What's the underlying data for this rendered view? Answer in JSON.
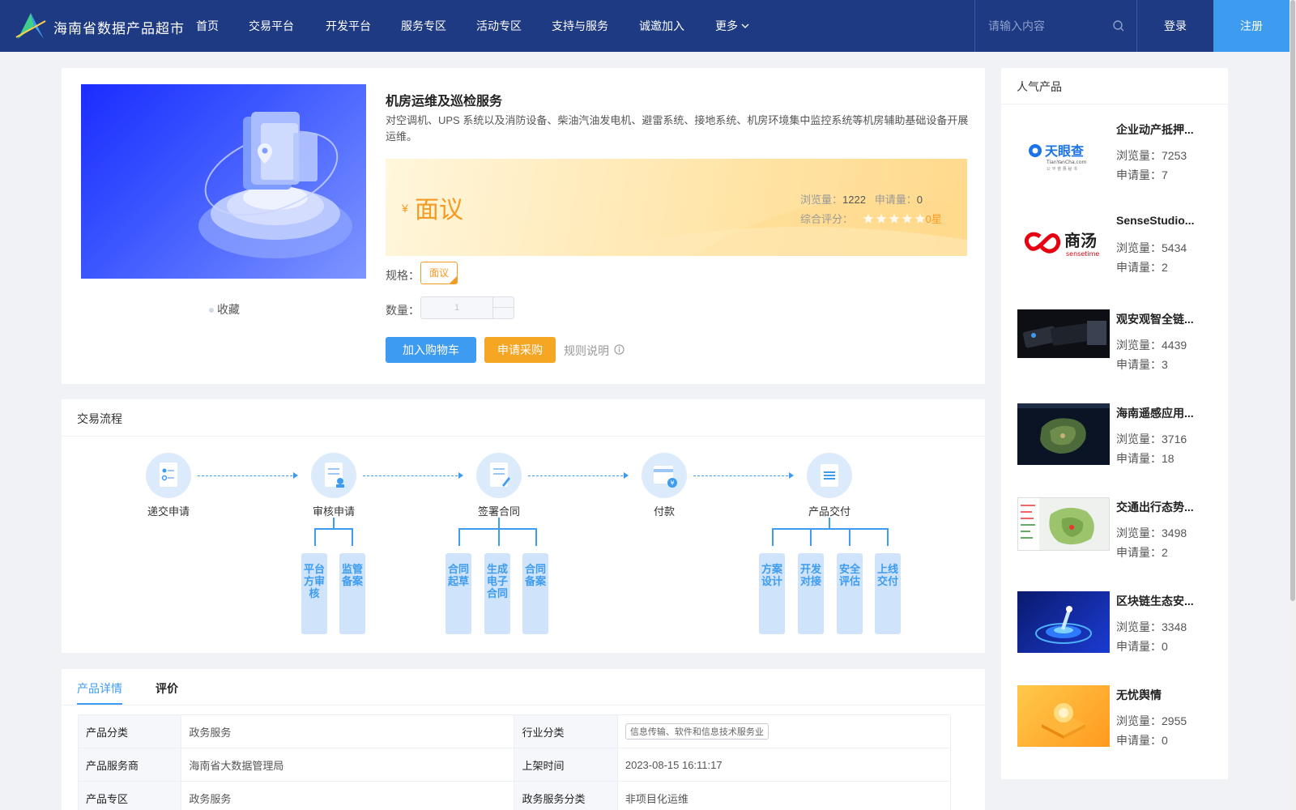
{
  "header": {
    "brand": "海南省数据产品超市",
    "nav": [
      "首页",
      "交易平台",
      "开发平台",
      "服务专区",
      "活动专区",
      "支持与服务",
      "诚邀加入",
      "更多"
    ],
    "search_placeholder": "请输入内容",
    "login": "登录",
    "register": "注册",
    "colors": {
      "bar": "#1d3a82",
      "accent": "#3e9cf0"
    }
  },
  "product": {
    "title": "机房运维及巡检服务",
    "description": "对空调机、UPS 系统以及消防设备、柴油汽油发电机、避雷系统、接地系统、机房环境集中监控系统等机房辅助基础设备开展运维。",
    "favorite": "收藏",
    "currency": "¥",
    "price": "面议",
    "views_label": "浏览量：",
    "views": "1222",
    "applies_label": "申请量：",
    "applies": "0",
    "rating_label": "综合评分：",
    "rating_value": "0星",
    "rating_stars_filled": 0,
    "rating_stars_total": 5,
    "spec_label": "规格：",
    "spec_value": "面议",
    "qty_label": "数量：",
    "qty_value": "1",
    "add_cart": "加入购物车",
    "apply_purchase": "申请采购",
    "rules": "规则说明",
    "price_color": "#f59a23"
  },
  "process": {
    "title": "交易流程",
    "steps": [
      {
        "label": "递交申请",
        "icon": "document-form-icon",
        "subs": []
      },
      {
        "label": "审核申请",
        "icon": "document-review-icon",
        "subs": [
          "平台方审核",
          "监管备案"
        ]
      },
      {
        "label": "签署合同",
        "icon": "contract-sign-icon",
        "subs": [
          "合同起草",
          "生成电子合同",
          "合同备案"
        ]
      },
      {
        "label": "付款",
        "icon": "payment-icon",
        "subs": []
      },
      {
        "label": "产品交付",
        "icon": "delivery-icon",
        "subs": [
          "方案设计",
          "开发对接",
          "安全评估",
          "上线交付"
        ]
      }
    ]
  },
  "details": {
    "tabs": [
      "产品详情",
      "评价"
    ],
    "rows": [
      {
        "k1": "产品分类",
        "v1": "政务服务",
        "k2": "行业分类",
        "v2": "信息传输、软件和信息技术服务业",
        "v2_tag": true
      },
      {
        "k1": "产品服务商",
        "v1": "海南省大数据管理局",
        "k2": "上架时间",
        "v2": "2023-08-15 16:11:17",
        "v2_tag": false
      },
      {
        "k1": "产品专区",
        "v1": "政务服务",
        "k2": "政务服务分类",
        "v2": "非项目化运维",
        "v2_tag": false
      }
    ]
  },
  "popular": {
    "title": "人气产品",
    "views_label": "浏览量：",
    "applies_label": "申请量：",
    "items": [
      {
        "name": "企业动产抵押...",
        "views": "7253",
        "applies": "7",
        "thumb": "tianyancha-logo"
      },
      {
        "name": "SenseStudio...",
        "views": "5434",
        "applies": "2",
        "thumb": "sensetime-logo"
      },
      {
        "name": "观安观智全链...",
        "views": "4439",
        "applies": "3",
        "thumb": "device-photo"
      },
      {
        "name": "海南遥感应用...",
        "views": "3716",
        "applies": "18",
        "thumb": "satellite-map"
      },
      {
        "name": "交通出行态势...",
        "views": "3498",
        "applies": "2",
        "thumb": "traffic-map"
      },
      {
        "name": "区块链生态安...",
        "views": "3348",
        "applies": "0",
        "thumb": "blockchain-art"
      },
      {
        "name": "无忧舆情",
        "views": "2955",
        "applies": "0",
        "thumb": "sentiment-art"
      }
    ],
    "logo_text": {
      "tianyancha": "天眼查",
      "tianyancha_sub": "TianYanCha.com",
      "tianyancha_slogan": "公 平 普 惠 秘 书",
      "sensetime": "商汤",
      "sensetime_sub": "sensetime"
    }
  }
}
